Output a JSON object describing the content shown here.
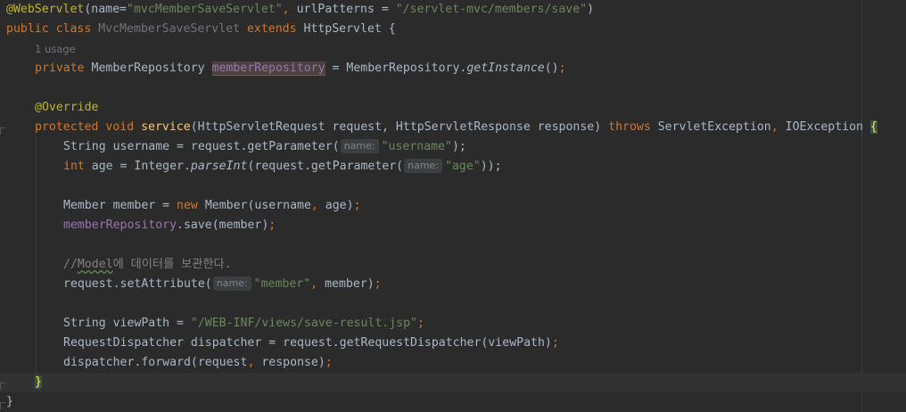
{
  "code": {
    "l1_annotation": "@WebServlet",
    "l1_paren_open": "(",
    "l1_name_key": "name=",
    "l1_name_val": "\"mvcMemberSaveServlet\"",
    "l1_sep": ", ",
    "l1_url_key": "urlPatterns = ",
    "l1_url_val": "\"/servlet-mvc/members/save\"",
    "l1_paren_close": ")",
    "l2_public": "public ",
    "l2_class": "class ",
    "l2_classname": "MvcMemberSaveServlet",
    "l2_extends": " extends ",
    "l2_super": "HttpServlet {",
    "l3_usage": "1 usage",
    "l4_private": "private ",
    "l4_type": "MemberRepository ",
    "l4_field": "memberRepository",
    "l4_assign": " = MemberRepository.",
    "l4_method": "getInstance",
    "l4_end": "()",
    "l4_semi": ";",
    "l6_override": "@Override",
    "l7_protected": "protected ",
    "l7_void": "void ",
    "l7_service": "service",
    "l7_params": "(HttpServletRequest request, HttpServletResponse response) ",
    "l7_throws": "throws ",
    "l7_ex1": "ServletException",
    "l7_comma": ", ",
    "l7_ex2": "IOException ",
    "l7_brace": "{",
    "l8_a": "String username = request.getParameter(",
    "l8_hint": "name:",
    "l8_str": "\"username\"",
    "l8_b": ");",
    "l9_int": "int ",
    "l9_a": "age = Integer.",
    "l9_parse": "parseInt",
    "l9_b": "(request.getParameter(",
    "l9_hint": "name:",
    "l9_str": "\"age\"",
    "l9_c": "));",
    "l11_a": "Member member = ",
    "l11_new": "new ",
    "l11_b": "Member(username",
    "l11_comma": ", ",
    "l11_c": "age)",
    "l11_semi": ";",
    "l12_field": "memberRepository",
    "l12_b": ".save(member)",
    "l12_semi": ";",
    "l14_slashes": "//",
    "l14_model": "Model",
    "l14_rest": "에 데이터를 보관한다.",
    "l15_a": "request.setAttribute(",
    "l15_hint": "name:",
    "l15_str": "\"member\"",
    "l15_comma": ", ",
    "l15_b": "member)",
    "l15_semi": ";",
    "l17_a": "String viewPath = ",
    "l17_str": "\"/WEB-INF/views/save-result.jsp\"",
    "l17_semi": ";",
    "l18_a": "RequestDispatcher dispatcher = request.getRequestDispatcher(viewPath)",
    "l18_semi": ";",
    "l19_a": "dispatcher.forward(request",
    "l19_comma": ", ",
    "l19_b": "response)",
    "l19_semi": ";",
    "l20_brace": "}",
    "l21_brace": "}"
  }
}
